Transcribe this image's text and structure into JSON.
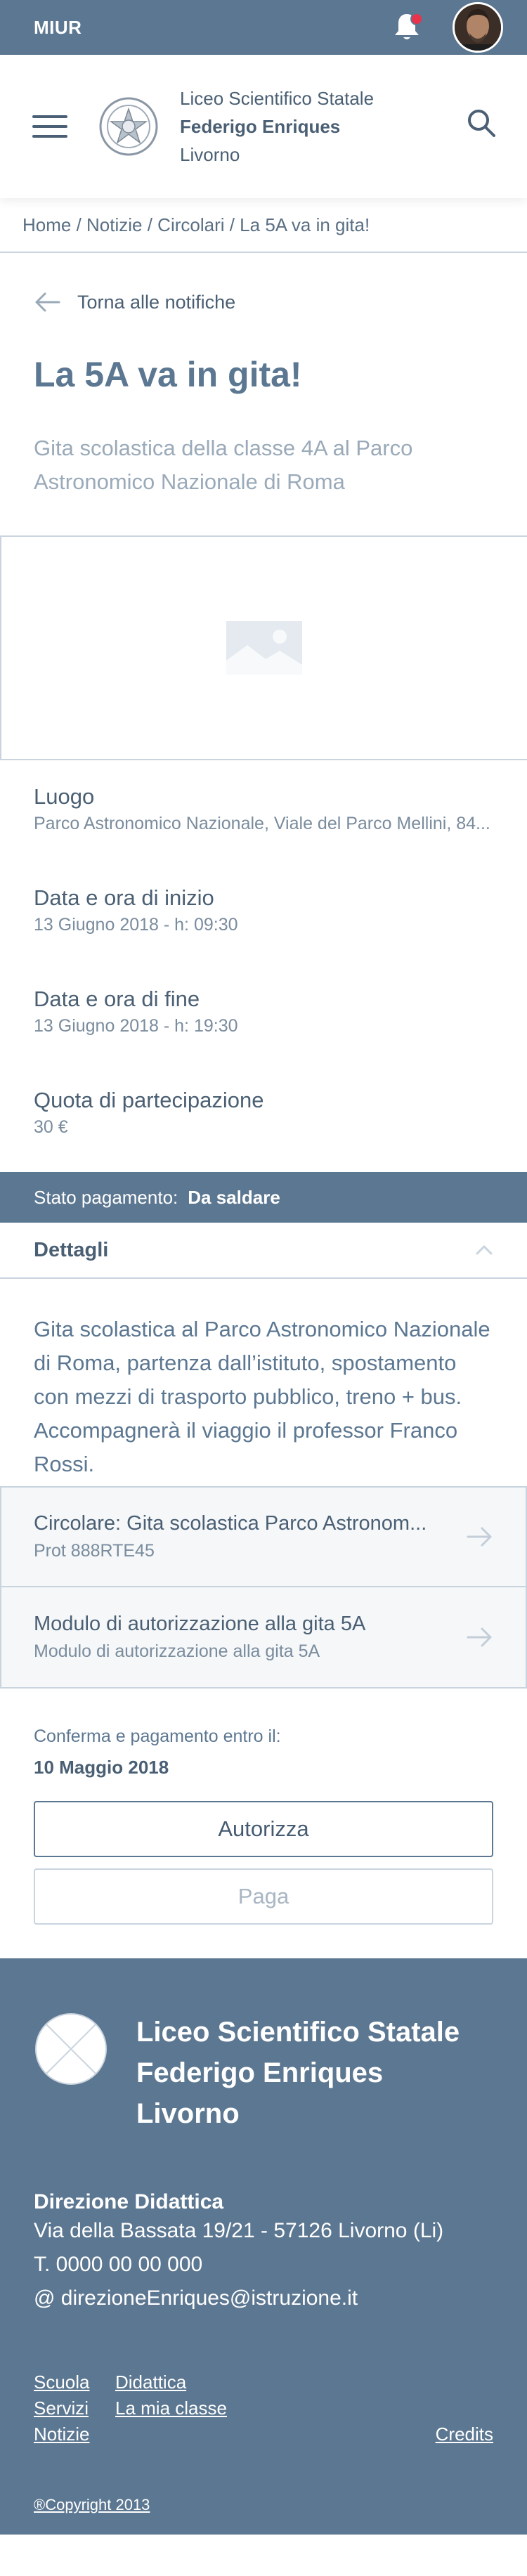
{
  "topbar": {
    "brand": "MIUR"
  },
  "header": {
    "school_line1": "Liceo Scientifico Statale",
    "school_line2": "Federigo Enriques",
    "school_line3": "Livorno"
  },
  "breadcrumb": "Home / Notizie / Circolari / La 5A va in gita!",
  "back_label": "Torna alle notifiche",
  "title": "La 5A va in gita!",
  "subtitle": "Gita scolastica della classe 4A al Parco Astronomico Nazionale di Roma",
  "info": [
    {
      "label": "Luogo",
      "value": "Parco Astronomico Nazionale, Viale del Parco Mellini, 84..."
    },
    {
      "label": "Data e ora di inizio",
      "value": "13 Giugno 2018 - h: 09:30"
    },
    {
      "label": "Data e ora di fine",
      "value": "13 Giugno 2018 - h: 19:30"
    },
    {
      "label": "Quota di partecipazione",
      "value": "30 €"
    }
  ],
  "status": {
    "label": "Stato pagamento:",
    "value": "Da saldare"
  },
  "details": {
    "label": "Dettagli",
    "text": "Gita scolastica al Parco Astronomico Nazionale di Roma, partenza dall’istituto, spostamento con mezzi di trasporto pubblico, treno + bus. Accompagnerà il viaggio il professor Franco Rossi."
  },
  "attachments": [
    {
      "title": "Circolare: Gita scolastica Parco Astronom...",
      "subtitle": "Prot 888RTE45"
    },
    {
      "title": "Modulo di autorizzazione alla gita 5A",
      "subtitle": "Modulo di autorizzazione alla gita 5A"
    }
  ],
  "confirm": {
    "label": "Conferma e pagamento entro il:",
    "date": "10 Maggio 2018"
  },
  "buttons": {
    "authorize": "Autorizza",
    "pay": "Paga"
  },
  "footer": {
    "school_line1": "Liceo Scientifico Statale",
    "school_line2": "Federigo Enriques",
    "school_line3": "Livorno",
    "direction": "Direzione Didattica",
    "address": "Via della Bassata 19/21 - 57126 Livorno (Li)",
    "phone": "T. 0000 00 00 000",
    "email": "@ direzioneEnriques@istruzione.it",
    "links": {
      "scuola": "Scuola",
      "didattica": "Didattica",
      "servizi": "Servizi",
      "classe": "La mia classe",
      "notizie": "Notizie",
      "credits": "Credits"
    },
    "copyright": "®Copyright 2013"
  },
  "colors": {
    "primary": "#5c7791",
    "border": "#c9d4df",
    "notification": "#e8334a"
  },
  "icons": [
    "bell-icon",
    "avatar",
    "hamburger-icon",
    "emblem-icon",
    "search-icon",
    "arrow-left-icon",
    "image-placeholder-icon",
    "chevron-up-icon",
    "arrow-right-icon"
  ]
}
